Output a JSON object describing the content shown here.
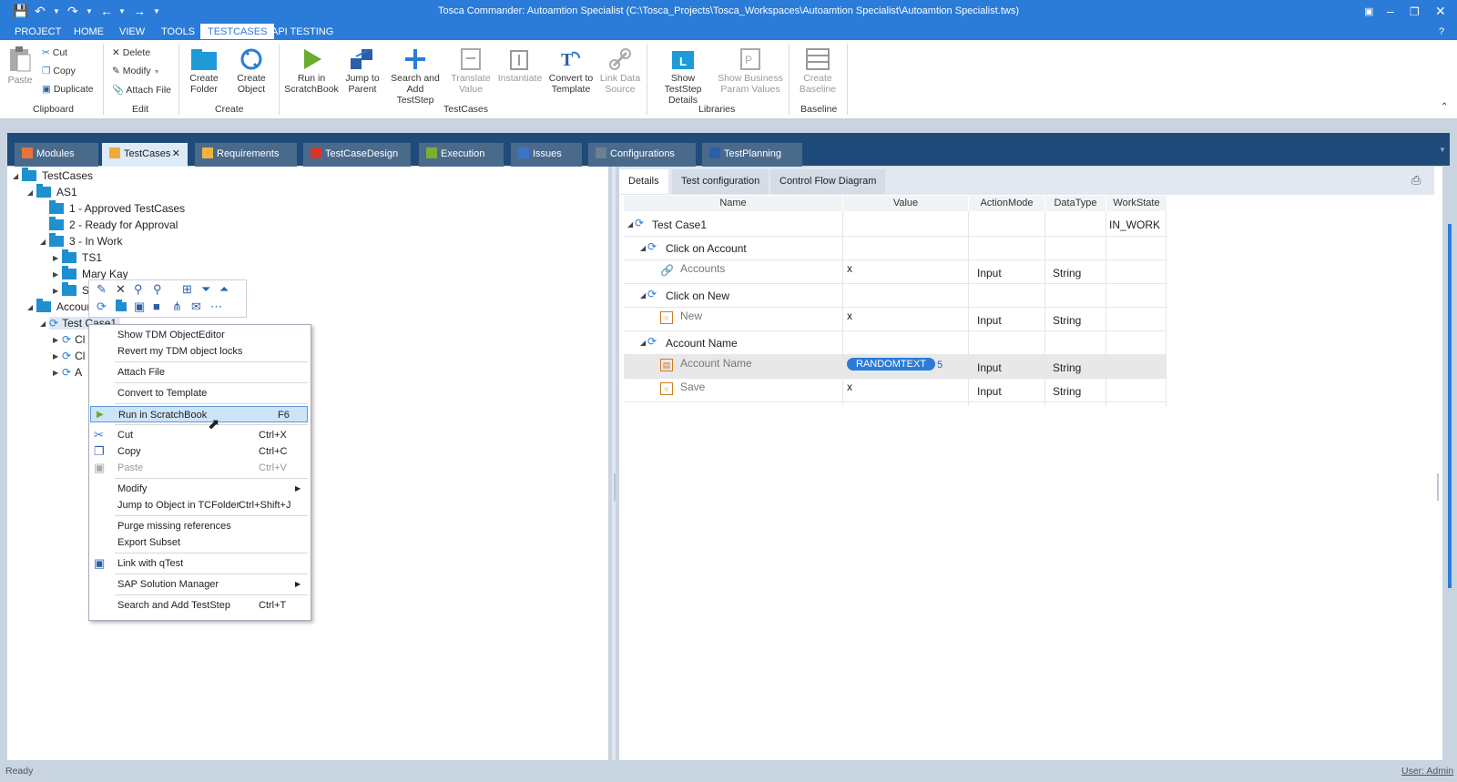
{
  "window": {
    "title": "Tosca Commander: Autoamtion Specialist (C:\\Tosca_Projects\\Tosca_Workspaces\\Autoamtion Specialist\\Autoamtion Specialist.tws)"
  },
  "menu": [
    "PROJECT",
    "HOME",
    "VIEW",
    "TOOLS",
    "TESTCASES",
    "API TESTING"
  ],
  "ribbon": {
    "paste": "Paste",
    "cut": "Cut",
    "copy": "Copy",
    "duplicate": "Duplicate",
    "delete": "Delete",
    "modify": "Modify",
    "attach_file": "Attach File",
    "create_folder": [
      "Create",
      "Folder"
    ],
    "create_object": [
      "Create",
      "Object"
    ],
    "run_scratchbook": [
      "Run in",
      "ScratchBook"
    ],
    "jump_parent": [
      "Jump to",
      "Parent"
    ],
    "search_add": [
      "Search and",
      "Add TestStep"
    ],
    "translate_value": [
      "Translate",
      "Value"
    ],
    "instantiate": "Instantiate",
    "convert_template": [
      "Convert to",
      "Template"
    ],
    "link_data_source": [
      "Link Data",
      "Source"
    ],
    "show_teststep_details": [
      "Show TestStep",
      "Details"
    ],
    "show_business_param": [
      "Show Business",
      "Param Values"
    ],
    "create_baseline": [
      "Create",
      "Baseline"
    ],
    "groups": {
      "clipboard": "Clipboard",
      "edit": "Edit",
      "create": "Create",
      "testcases": "TestCases",
      "libraries": "Libraries",
      "baseline": "Baseline"
    }
  },
  "tabs": [
    "Modules",
    "TestCases",
    "Requirements",
    "TestCaseDesign",
    "Execution",
    "Issues",
    "Configurations",
    "TestPlanning"
  ],
  "tab_colors": [
    "#e8733a",
    "#f2a93b",
    "#f2b43c",
    "#d8352a",
    "#7ab02f",
    "#3c73c8",
    "#6b7f95",
    "#4a6a8c"
  ],
  "tree": {
    "root": "TestCases",
    "as1": "AS1",
    "approved": "1 - Approved TestCases",
    "ready": "2 - Ready for Approval",
    "in_work": "3 - In Work",
    "ts1": "TS1",
    "mary": "Mary Kay",
    "sc": "Sc",
    "accoun": "Accoun",
    "testcase": "Test Case1",
    "c1": "Cl",
    "c2": "Cl",
    "a1": "A"
  },
  "context_menu": {
    "show_tdm": "Show TDM ObjectEditor",
    "revert_locks": "Revert my TDM object locks",
    "attach_file": "Attach File",
    "convert_template": "Convert to Template",
    "run_scratchbook": "Run in ScratchBook",
    "run_shortcut": "F6",
    "cut": "Cut",
    "cut_shortcut": "Ctrl+X",
    "copy": "Copy",
    "copy_shortcut": "Ctrl+C",
    "paste": "Paste",
    "paste_shortcut": "Ctrl+V",
    "modify": "Modify",
    "jump_object": "Jump to Object in TCFolder",
    "jump_shortcut": "Ctrl+Shift+J",
    "purge": "Purge missing references",
    "export_subset": "Export Subset",
    "link_qtest": "Link with qTest",
    "sap": "SAP Solution Manager",
    "search_add": "Search and Add TestStep",
    "search_shortcut": "Ctrl+T"
  },
  "details": {
    "tabs": [
      "Details",
      "Test configuration",
      "Control Flow Diagram"
    ],
    "headers": [
      "Name",
      "Value",
      "ActionMode",
      "DataType",
      "WorkState"
    ],
    "testcase": {
      "name": "Test Case1",
      "workstate": "IN_WORK"
    },
    "rows": [
      {
        "name": "Click on Account"
      },
      {
        "name": "Accounts",
        "value": "x",
        "action": "Input",
        "type": "String"
      },
      {
        "name": "Click on New"
      },
      {
        "name": "New",
        "value": "x",
        "action": "Input",
        "type": "String"
      },
      {
        "name": "Account Name"
      },
      {
        "name": "Account Name",
        "value": "RANDOMTEXT",
        "value_extra": "5",
        "action": "Input",
        "type": "String"
      },
      {
        "name": "Save",
        "value": "x",
        "action": "Input",
        "type": "String"
      }
    ]
  },
  "status": {
    "left": "Ready",
    "right": "User: Admin"
  }
}
